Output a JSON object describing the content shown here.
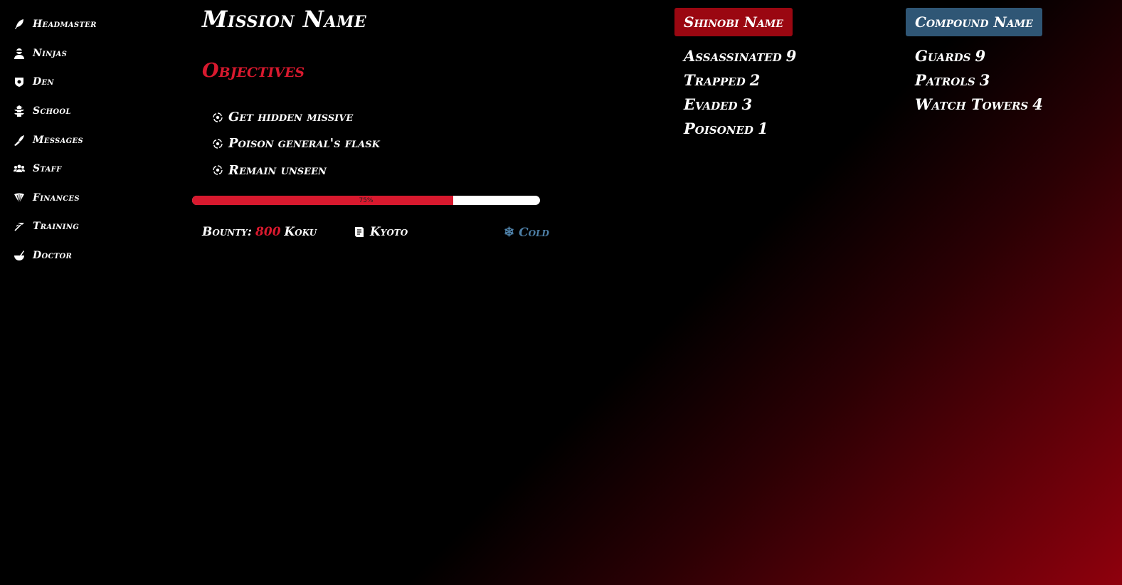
{
  "sidebar": {
    "items": [
      {
        "label": "Headmaster",
        "icon": "quill-icon"
      },
      {
        "label": "Ninjas",
        "icon": "ninja-icon"
      },
      {
        "label": "Den",
        "icon": "shield-icon"
      },
      {
        "label": "School",
        "icon": "pagoda-icon"
      },
      {
        "label": "Messages",
        "icon": "bird-icon"
      },
      {
        "label": "Staff",
        "icon": "users-icon"
      },
      {
        "label": "Finances",
        "icon": "fan-icon"
      },
      {
        "label": "Training",
        "icon": "running-icon"
      },
      {
        "label": "Doctor",
        "icon": "mortar-icon"
      }
    ]
  },
  "mission": {
    "title": "Mission Name",
    "objectives_title": "Objectives",
    "objectives": [
      "Get hidden missive",
      "Poison general's flask",
      "Remain unseen"
    ],
    "objective_icon": "shuriken-icon",
    "progress_fraction": 0.75,
    "progress_label": "75%",
    "bounty_label": "Bounty:",
    "bounty_amount": "800",
    "bounty_unit": "Koku",
    "location": "Kyoto",
    "weather": "Cold",
    "weather_icon": "snowflake-icon"
  },
  "shinobi": {
    "name": "Shinobi Name",
    "stats": [
      {
        "label": "Assassinated",
        "value": "9"
      },
      {
        "label": "Trapped",
        "value": "2"
      },
      {
        "label": "Evaded",
        "value": "3"
      },
      {
        "label": "Poisoned",
        "value": "1"
      }
    ]
  },
  "compound": {
    "name": "Compound Name",
    "stats": [
      {
        "label": "Guards",
        "value": "9"
      },
      {
        "label": "Patrols",
        "value": "3"
      },
      {
        "label": "Watch Towers",
        "value": "4"
      }
    ]
  },
  "colors": {
    "accent_red": "#d8192e",
    "shinobi_badge": "#9a0711",
    "compound_badge": "#2f5675",
    "weather_blue": "#4d7fa6"
  }
}
